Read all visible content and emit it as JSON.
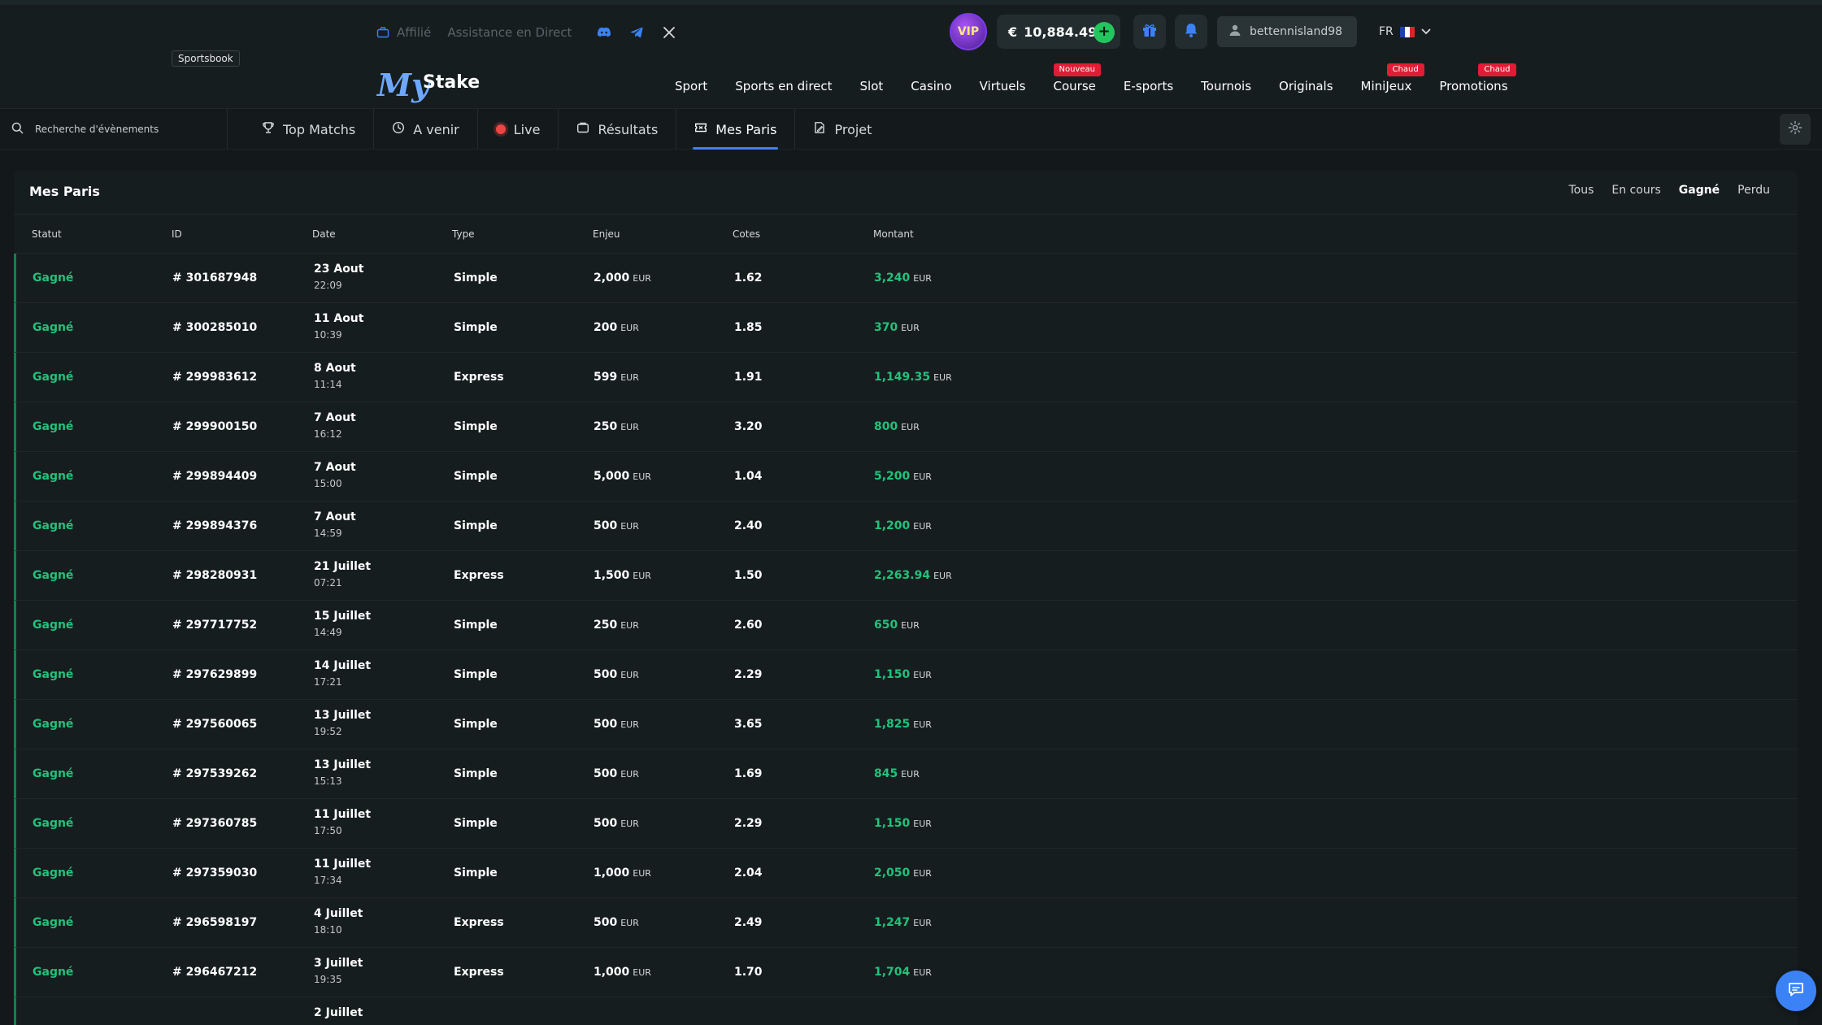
{
  "header": {
    "sportsbook_tag": "Sportsbook",
    "affiliate_label": "Affilié",
    "support_label": "Assistance en Direct",
    "social_icons": [
      "discord-icon",
      "telegram-icon",
      "x-icon"
    ],
    "logo_text": "MyStake",
    "vip_label": "VIP",
    "balance_currency": "€",
    "balance_value": "10,884.49",
    "username": "bettennisland98",
    "language": "FR",
    "nav": [
      {
        "label": "Sport",
        "badge": ""
      },
      {
        "label": "Sports en direct",
        "badge": ""
      },
      {
        "label": "Slot",
        "badge": ""
      },
      {
        "label": "Casino",
        "badge": ""
      },
      {
        "label": "Virtuels",
        "badge": ""
      },
      {
        "label": "Course",
        "badge": "Nouveau"
      },
      {
        "label": "E-sports",
        "badge": ""
      },
      {
        "label": "Tournois",
        "badge": ""
      },
      {
        "label": "Originals",
        "badge": ""
      },
      {
        "label": "MiniJeux",
        "badge": "Chaud"
      },
      {
        "label": "Promotions",
        "badge": "Chaud"
      }
    ]
  },
  "subbar": {
    "search_placeholder": "Recherche d'évènements",
    "tabs": [
      {
        "label": "Top Matchs",
        "icon": "trophy-icon"
      },
      {
        "label": "A venir",
        "icon": "clock-icon"
      },
      {
        "label": "Live",
        "icon": "live-dot-icon"
      },
      {
        "label": "Résultats",
        "icon": "results-icon"
      },
      {
        "label": "Mes Paris",
        "icon": "ticket-icon",
        "active": true
      },
      {
        "label": "Projet",
        "icon": "draft-icon"
      }
    ]
  },
  "panel": {
    "title": "Mes Paris",
    "filters": [
      "Tous",
      "En cours",
      "Gagné",
      "Perdu"
    ],
    "active_filter": "Gagné",
    "columns": [
      "Statut",
      "ID",
      "Date",
      "Type",
      "Enjeu",
      "Cotes",
      "Montant"
    ],
    "currency": "EUR",
    "rows": [
      {
        "status": "Gagné",
        "id": "# 301687948",
        "date": "23 Aout",
        "time": "22:09",
        "type": "Simple",
        "stake": "2,000",
        "odds": "1.62",
        "amount": "3,240"
      },
      {
        "status": "Gagné",
        "id": "# 300285010",
        "date": "11 Aout",
        "time": "10:39",
        "type": "Simple",
        "stake": "200",
        "odds": "1.85",
        "amount": "370"
      },
      {
        "status": "Gagné",
        "id": "# 299983612",
        "date": "8 Aout",
        "time": "11:14",
        "type": "Express",
        "stake": "599",
        "odds": "1.91",
        "amount": "1,149.35"
      },
      {
        "status": "Gagné",
        "id": "# 299900150",
        "date": "7 Aout",
        "time": "16:12",
        "type": "Simple",
        "stake": "250",
        "odds": "3.20",
        "amount": "800"
      },
      {
        "status": "Gagné",
        "id": "# 299894409",
        "date": "7 Aout",
        "time": "15:00",
        "type": "Simple",
        "stake": "5,000",
        "odds": "1.04",
        "amount": "5,200"
      },
      {
        "status": "Gagné",
        "id": "# 299894376",
        "date": "7 Aout",
        "time": "14:59",
        "type": "Simple",
        "stake": "500",
        "odds": "2.40",
        "amount": "1,200"
      },
      {
        "status": "Gagné",
        "id": "# 298280931",
        "date": "21 Juillet",
        "time": "07:21",
        "type": "Express",
        "stake": "1,500",
        "odds": "1.50",
        "amount": "2,263.94"
      },
      {
        "status": "Gagné",
        "id": "# 297717752",
        "date": "15 Juillet",
        "time": "14:49",
        "type": "Simple",
        "stake": "250",
        "odds": "2.60",
        "amount": "650"
      },
      {
        "status": "Gagné",
        "id": "# 297629899",
        "date": "14 Juillet",
        "time": "17:21",
        "type": "Simple",
        "stake": "500",
        "odds": "2.29",
        "amount": "1,150"
      },
      {
        "status": "Gagné",
        "id": "# 297560065",
        "date": "13 Juillet",
        "time": "19:52",
        "type": "Simple",
        "stake": "500",
        "odds": "3.65",
        "amount": "1,825"
      },
      {
        "status": "Gagné",
        "id": "# 297539262",
        "date": "13 Juillet",
        "time": "15:13",
        "type": "Simple",
        "stake": "500",
        "odds": "1.69",
        "amount": "845"
      },
      {
        "status": "Gagné",
        "id": "# 297360785",
        "date": "11 Juillet",
        "time": "17:50",
        "type": "Simple",
        "stake": "500",
        "odds": "2.29",
        "amount": "1,150"
      },
      {
        "status": "Gagné",
        "id": "# 297359030",
        "date": "11 Juillet",
        "time": "17:34",
        "type": "Simple",
        "stake": "1,000",
        "odds": "2.04",
        "amount": "2,050"
      },
      {
        "status": "Gagné",
        "id": "# 296598197",
        "date": "4 Juillet",
        "time": "18:10",
        "type": "Express",
        "stake": "500",
        "odds": "2.49",
        "amount": "1,247"
      },
      {
        "status": "Gagné",
        "id": "# 296467212",
        "date": "3 Juillet",
        "time": "19:35",
        "type": "Express",
        "stake": "1,000",
        "odds": "1.70",
        "amount": "1,704"
      },
      {
        "status": "",
        "id": "",
        "date": "2 Juillet",
        "time": "",
        "type": "",
        "stake": "",
        "odds": "",
        "amount": ""
      }
    ]
  },
  "colors": {
    "background": "#13191b",
    "panel": "#161d1f",
    "won_green": "#22c27a",
    "accent_blue": "#3b82f6",
    "badge_red": "#e11d35",
    "deposit_green": "#22c55e"
  }
}
